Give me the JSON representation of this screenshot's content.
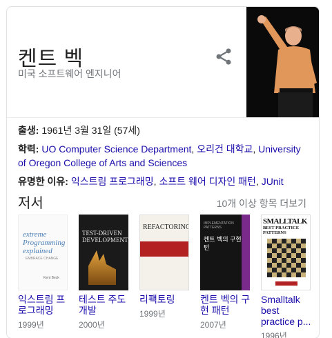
{
  "entity": {
    "name": "켄트 벡",
    "subtitle": "미국 소프트웨어 엔지니어"
  },
  "facts": {
    "born": {
      "label": "출생:",
      "value": " 1961년 3월 31일 (57세)"
    },
    "education": {
      "label": "학력:",
      "links": [
        "UO Computer Science Department",
        "오리건 대학교",
        "University of Oregon College of Arts and Sciences"
      ]
    },
    "known_for": {
      "label": "유명한 이유:",
      "links": [
        "익스트림 프로그래밍",
        "소프트 웨어 디자인 패턴",
        "JUnit"
      ]
    }
  },
  "books_section": {
    "title": "저서",
    "more_label": "10개 이상 항목 더보기",
    "items": [
      {
        "title": "익스트림 프로그래밍",
        "year": "1999년"
      },
      {
        "title": "테스트 주도 개발",
        "year": "2000년"
      },
      {
        "title": "리팩토링",
        "year": "1999년"
      },
      {
        "title": "켄트 벡의 구현 패턴",
        "year": "2007년"
      },
      {
        "title": "Smalltalk best practice p...",
        "year": "1996년"
      }
    ]
  },
  "covers": {
    "c1_title": "extreme Programming explained",
    "c1_sub": "EMBRACE CHANGE",
    "c1_author": "Kent Beck",
    "c2_title": "TEST-DRIVEN DEVELOPMENT",
    "c3_title": "REFACTORING",
    "c4_series": "IMPLEMENTATION PATTERNS",
    "c4_title": "켄트 벡의 구현 패턴",
    "c5_title": "SMALLTALK",
    "c5_sub": "BEST PRACTICE PATTERNS"
  },
  "colors": {
    "link": "#1a0dab",
    "muted": "#70757a",
    "text": "#222222",
    "border": "#dfe1e5"
  },
  "icons": {
    "share": "share-icon"
  }
}
